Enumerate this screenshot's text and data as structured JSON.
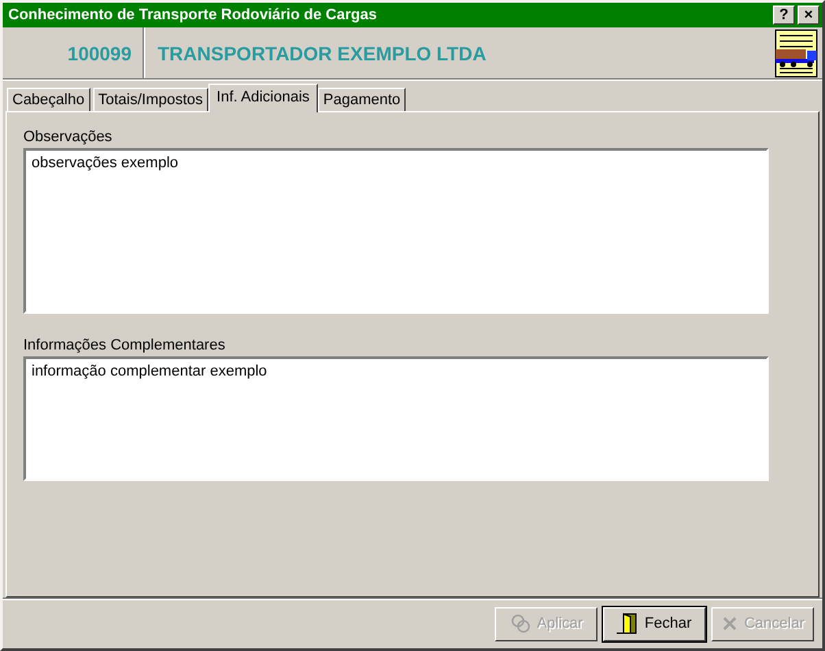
{
  "window": {
    "title": "Conhecimento de Transporte Rodoviário de Cargas",
    "controls": [
      "?",
      "×"
    ]
  },
  "header": {
    "code": "100099",
    "name": "TRANSPORTADOR EXEMPLO LTDA"
  },
  "tabs": [
    {
      "label": "Cabeçalho",
      "selected": false
    },
    {
      "label": "Totais/Impostos",
      "selected": false
    },
    {
      "label": "Inf. Adicionais",
      "selected": true
    },
    {
      "label": "Pagamento",
      "selected": false
    }
  ],
  "fields": [
    {
      "label": "Observações",
      "value": "observações exemplo"
    },
    {
      "label": "Informações Complementares",
      "value": "informação complementar exemplo"
    }
  ],
  "buttons": [
    {
      "label": "Aplicar",
      "kind": "apply",
      "disabled": true
    },
    {
      "label": "Fechar",
      "kind": "close",
      "disabled": false
    },
    {
      "label": "Cancelar",
      "kind": "cancel",
      "disabled": true
    }
  ]
}
